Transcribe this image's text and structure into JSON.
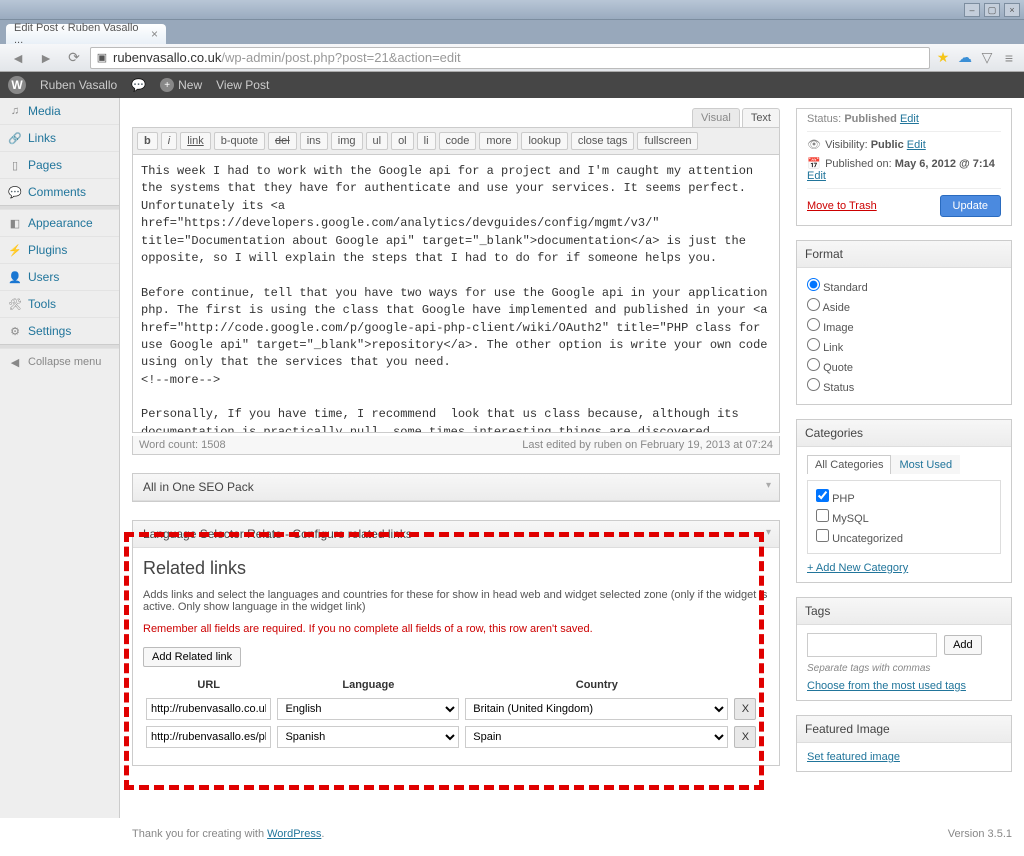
{
  "browser": {
    "tab_title": "Edit Post ‹ Ruben Vasallo ...",
    "url_host": "rubenvasallo.co.uk",
    "url_path": "/wp-admin/post.php?post=21&action=edit"
  },
  "adminbar": {
    "site": "Ruben Vasallo",
    "new": "New",
    "view": "View Post"
  },
  "menu": {
    "media": "Media",
    "links": "Links",
    "pages": "Pages",
    "comments": "Comments",
    "appearance": "Appearance",
    "plugins": "Plugins",
    "users": "Users",
    "tools": "Tools",
    "settings": "Settings",
    "collapse": "Collapse menu"
  },
  "editor": {
    "tab_visual": "Visual",
    "tab_text": "Text",
    "buttons": {
      "b": "b",
      "i": "i",
      "link": "link",
      "bquote": "b-quote",
      "del": "del",
      "ins": "ins",
      "img": "img",
      "ul": "ul",
      "ol": "ol",
      "li": "li",
      "code": "code",
      "more": "more",
      "lookup": "lookup",
      "close": "close tags",
      "fullscreen": "fullscreen"
    },
    "content": "This week I had to work with the Google api for a project and I'm caught my attention the systems that they have for authenticate and use your services. It seems perfect. Unfortunately its <a href=\"https://developers.google.com/analytics/devguides/config/mgmt/v3/\" title=\"Documentation about Google api\" target=\"_blank\">documentation</a> is just the opposite, so I will explain the steps that I had to do for if someone helps you.\n\nBefore continue, tell that you have two ways for use the Google api in your application php. The first is using the class that Google have implemented and published in your <a href=\"http://code.google.com/p/google-api-php-client/wiki/OAuth2\" title=\"PHP class for use Google api\" target=\"_blank\">repository</a>. The other option is write your own code using only that the services that you need.\n<!--more-->\n\nPersonally, If you have time, I recommend  look that us class because, although its documentation is practically null, some times interesting things are discovered.\n\nUnfortunately, the time is gold, and I decided choose the second option that, although it seems less good, us can help to understand how the system works.\n",
    "wordcount_label": "Word count:",
    "wordcount": "1508",
    "lastedit": "Last edited by ruben on February 19, 2013 at 07:24"
  },
  "seo_box_title": "All in One SEO Pack",
  "lsr": {
    "box_title": "Language Selector Relate - Configure related links",
    "heading": "Related links",
    "desc": "Adds links and select the languages and countries for these for show in head web and widget selected zone (only if the widget is active. Only show language in the widget link)",
    "warn": "Remember all fields are required. If you no complete all fields of a row, this row aren't saved.",
    "add_btn": "Add Related link",
    "th_url": "URL",
    "th_lang": "Language",
    "th_country": "Country",
    "rows": [
      {
        "url": "http://rubenvasallo.co.uk/ph",
        "lang": "English",
        "country": "Britain (United Kingdom)"
      },
      {
        "url": "http://rubenvasallo.es/php/g",
        "lang": "Spanish",
        "country": "Spain"
      }
    ],
    "x": "X"
  },
  "publish": {
    "status_label": "Status:",
    "status": "Published",
    "edit": "Edit",
    "vis_label": "Visibility:",
    "visibility": "Public",
    "pubon_label": "Published on:",
    "pubon": "May 6, 2012 @ 7:14",
    "trash": "Move to Trash",
    "update": "Update"
  },
  "format": {
    "title": "Format",
    "standard": "Standard",
    "aside": "Aside",
    "image": "Image",
    "link": "Link",
    "quote": "Quote",
    "status": "Status"
  },
  "categories": {
    "title": "Categories",
    "tab_all": "All Categories",
    "tab_used": "Most Used",
    "php": "PHP",
    "mysql": "MySQL",
    "uncat": "Uncategorized",
    "add": "+ Add New Category"
  },
  "tags": {
    "title": "Tags",
    "add": "Add",
    "hint": "Separate tags with commas",
    "choose": "Choose from the most used tags"
  },
  "featured": {
    "title": "Featured Image",
    "set": "Set featured image"
  },
  "footer": {
    "thank": "Thank you for creating with ",
    "wp": "WordPress",
    "version": "Version 3.5.1"
  }
}
